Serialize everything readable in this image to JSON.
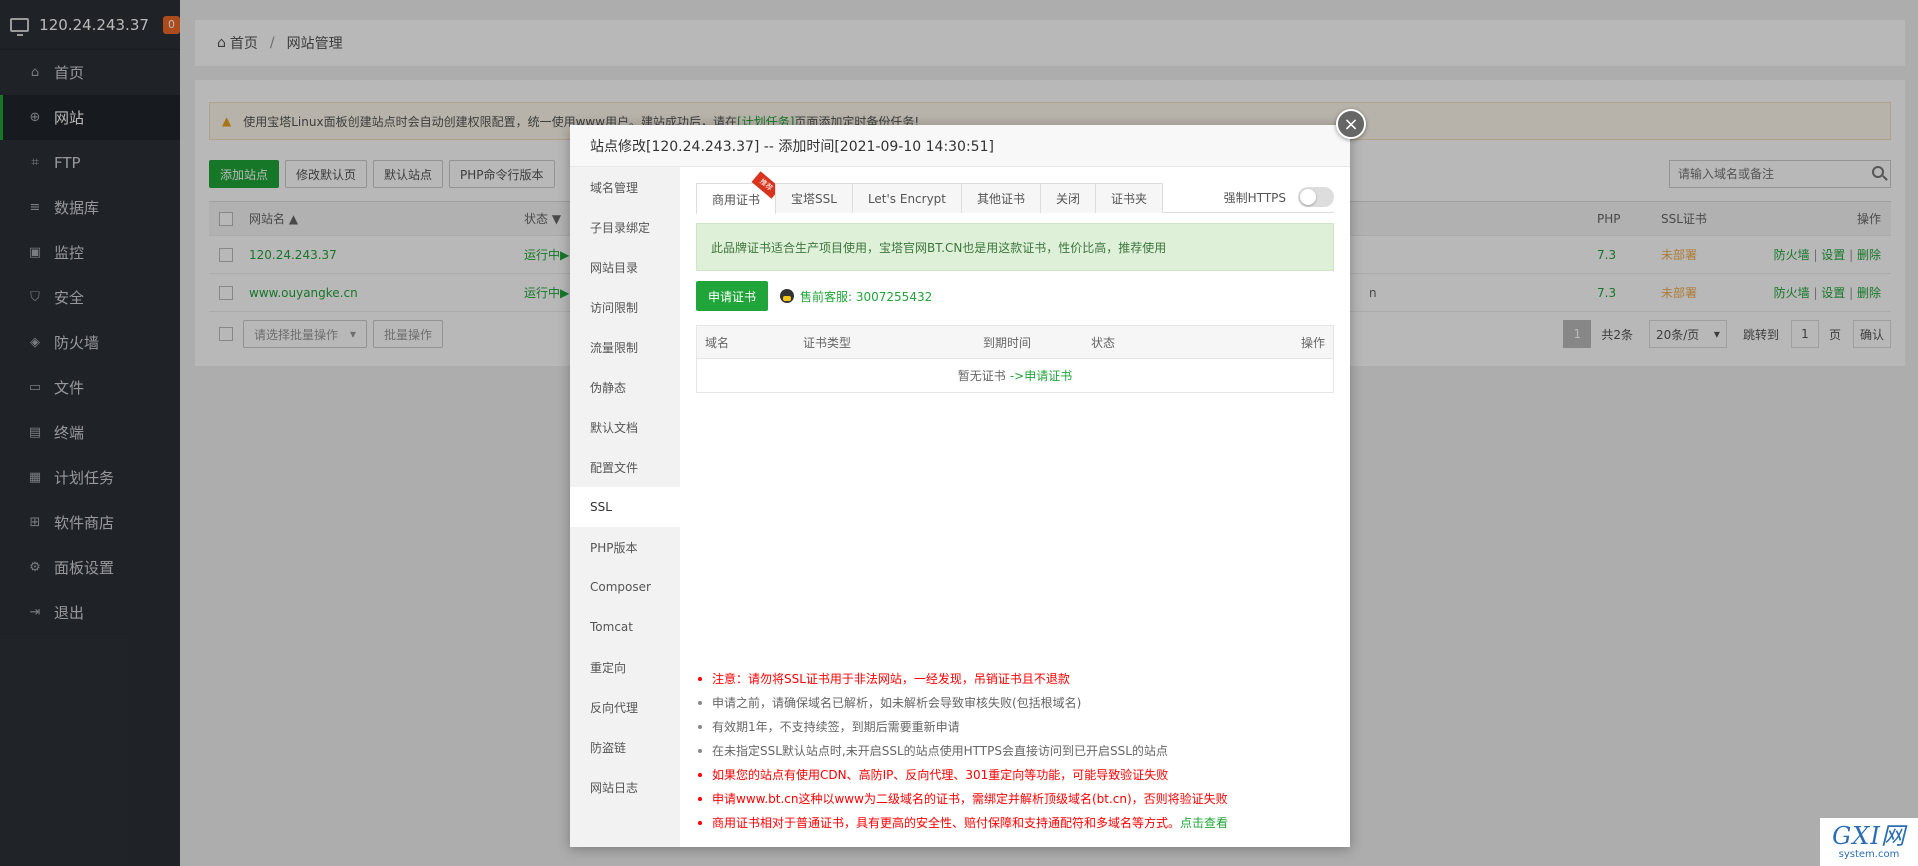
{
  "sidebar": {
    "ip": "120.24.243.37",
    "badge": "0",
    "items": [
      {
        "label": "首页",
        "icon": "home-icon",
        "glyph": "⌂"
      },
      {
        "label": "网站",
        "icon": "globe-icon",
        "glyph": "⊕"
      },
      {
        "label": "FTP",
        "icon": "ftp-icon",
        "glyph": "⌗"
      },
      {
        "label": "数据库",
        "icon": "database-icon",
        "glyph": "≡"
      },
      {
        "label": "监控",
        "icon": "monitor-icon",
        "glyph": "▣"
      },
      {
        "label": "安全",
        "icon": "shield-icon",
        "glyph": "⛉"
      },
      {
        "label": "防火墙",
        "icon": "firewall-icon",
        "glyph": "◈"
      },
      {
        "label": "文件",
        "icon": "folder-icon",
        "glyph": "▭"
      },
      {
        "label": "终端",
        "icon": "terminal-icon",
        "glyph": "▤"
      },
      {
        "label": "计划任务",
        "icon": "calendar-icon",
        "glyph": "▦"
      },
      {
        "label": "软件商店",
        "icon": "apps-icon",
        "glyph": "⊞"
      },
      {
        "label": "面板设置",
        "icon": "gear-icon",
        "glyph": "⚙"
      },
      {
        "label": "退出",
        "icon": "logout-icon",
        "glyph": "⇥"
      }
    ]
  },
  "breadcrumb": {
    "home": "首页",
    "sep": "/",
    "current": "网站管理"
  },
  "warning": {
    "text1": "使用宝塔Linux面板创建站点时会自动创建权限配置，统一使用www用户。建站成功后，请在",
    "link": "[计划任务]",
    "text2": "页面添加定时备份任务!"
  },
  "toolbar": {
    "add": "添加站点",
    "modify_default": "修改默认页",
    "default_site": "默认站点",
    "php_cli": "PHP命令行版本"
  },
  "search": {
    "placeholder": "请输入域名或备注"
  },
  "table": {
    "headers": {
      "name": "网站名 ▲",
      "status": "状态 ▼",
      "php": "PHP",
      "ssl": "SSL证书",
      "ops": "操作"
    },
    "rows": [
      {
        "name": "120.24.243.37",
        "status": "运行中▶",
        "remark": "",
        "php": "7.3",
        "ssl": "未部署",
        "firewall": "防火墙",
        "settings": "设置",
        "delete": "删除"
      },
      {
        "name": "www.ouyangke.cn",
        "status": "运行中▶",
        "remark": "n",
        "php": "7.3",
        "ssl": "未部署",
        "firewall": "防火墙",
        "settings": "设置",
        "delete": "删除"
      }
    ],
    "bulk_select": "请选择批量操作",
    "bulk_btn": "批量操作",
    "pager": {
      "page": "1",
      "total": "共2条",
      "per_page": "20条/页",
      "jump": "跳转到",
      "jump_val": "1",
      "unit": "页",
      "confirm": "确认"
    }
  },
  "modal": {
    "title": "站点修改[120.24.243.37] -- 添加时间[2021-09-10 14:30:51]",
    "close": "×",
    "menu": [
      "域名管理",
      "子目录绑定",
      "网站目录",
      "访问限制",
      "流量限制",
      "伪静态",
      "默认文档",
      "配置文件",
      "SSL",
      "PHP版本",
      "Composer",
      "Tomcat",
      "重定向",
      "反向代理",
      "防盗链",
      "网站日志"
    ],
    "tabs": [
      "商用证书",
      "宝塔SSL",
      "Let's Encrypt",
      "其他证书",
      "关闭",
      "证书夹"
    ],
    "ribbon": "推荐",
    "force_https": "强制HTTPS",
    "notice": "此品牌证书适合生产项目使用，宝塔官网BT.CN也是用这款证书，性价比高，推荐使用",
    "apply_btn": "申请证书",
    "qq": "售前客服: 3007255432",
    "cert_headers": {
      "domain": "域名",
      "type": "证书类型",
      "expire": "到期时间",
      "status": "状态",
      "ops": "操作"
    },
    "empty": "暂无证书",
    "empty_link": "->申请证书",
    "tips": [
      {
        "text": "注意：请勿将SSL证书用于非法网站，一经发现，吊销证书且不退款",
        "red": true
      },
      {
        "text": "申请之前，请确保域名已解析，如未解析会导致审核失败(包括根域名)",
        "red": false
      },
      {
        "text": "有效期1年，不支持续签，到期后需要重新申请",
        "red": false
      },
      {
        "text": "在未指定SSL默认站点时,未开启SSL的站点使用HTTPS会直接访问到已开启SSL的站点",
        "red": false
      },
      {
        "text": "如果您的站点有使用CDN、高防IP、反向代理、301重定向等功能，可能导致验证失败",
        "red": true
      },
      {
        "text": "申请www.bt.cn这种以www为二级域名的证书，需绑定并解析顶级域名(bt.cn)，否则将验证失败",
        "red": true
      },
      {
        "text": "商用证书相对于普通证书，具有更高的安全性、赔付保障和支持通配符和多域名等方式。",
        "red": true,
        "link": "点击查看"
      }
    ]
  },
  "watermark": {
    "line1": "GXI网",
    "line2": "system.com"
  }
}
